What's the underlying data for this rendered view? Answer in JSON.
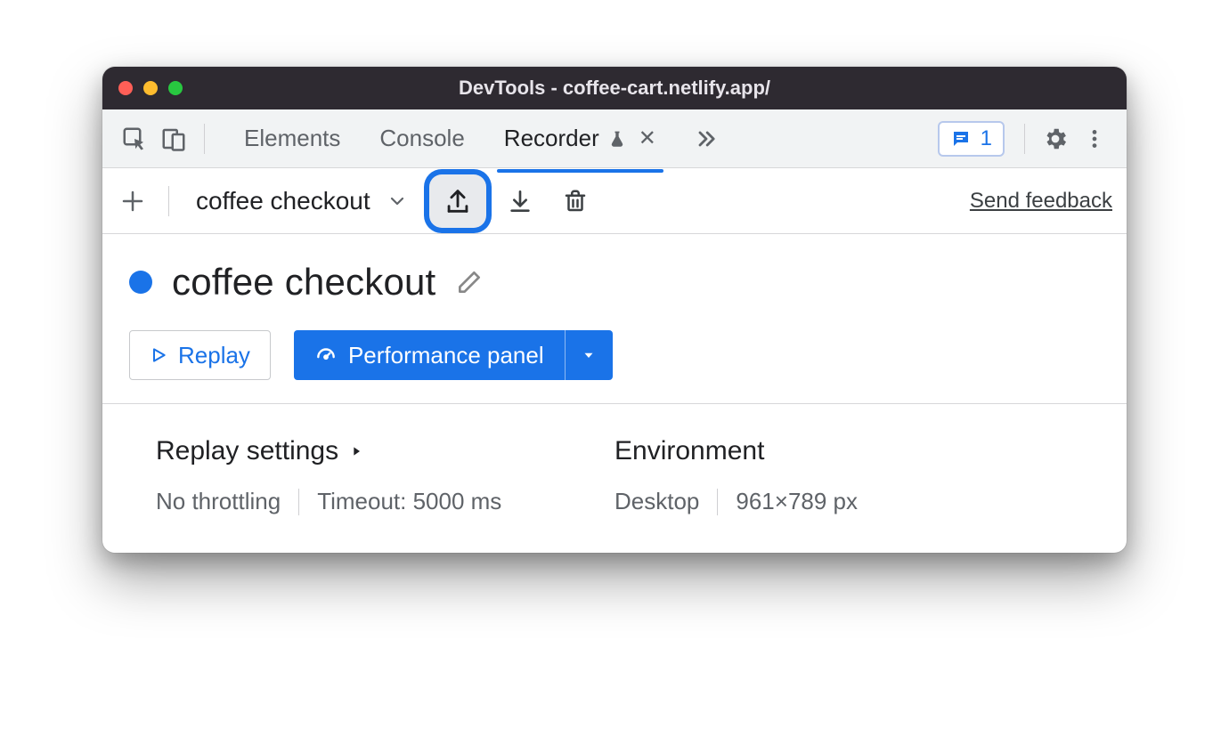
{
  "window": {
    "title": "DevTools - coffee-cart.netlify.app/"
  },
  "tabs": {
    "items": [
      {
        "label": "Elements",
        "active": false
      },
      {
        "label": "Console",
        "active": false
      },
      {
        "label": "Recorder",
        "active": true,
        "experimental": true,
        "closable": true
      }
    ],
    "overflow_icon": "chevron-double-right-icon",
    "issues_count": "1"
  },
  "toolbar": {
    "recording_select": "coffee checkout",
    "feedback": "Send feedback"
  },
  "recording": {
    "name": "coffee checkout",
    "replay_label": "Replay",
    "perf_label": "Performance panel"
  },
  "settings": {
    "replay_heading": "Replay settings",
    "throttling": "No throttling",
    "timeout": "Timeout: 5000 ms",
    "env_heading": "Environment",
    "device": "Desktop",
    "viewport": "961×789 px"
  }
}
